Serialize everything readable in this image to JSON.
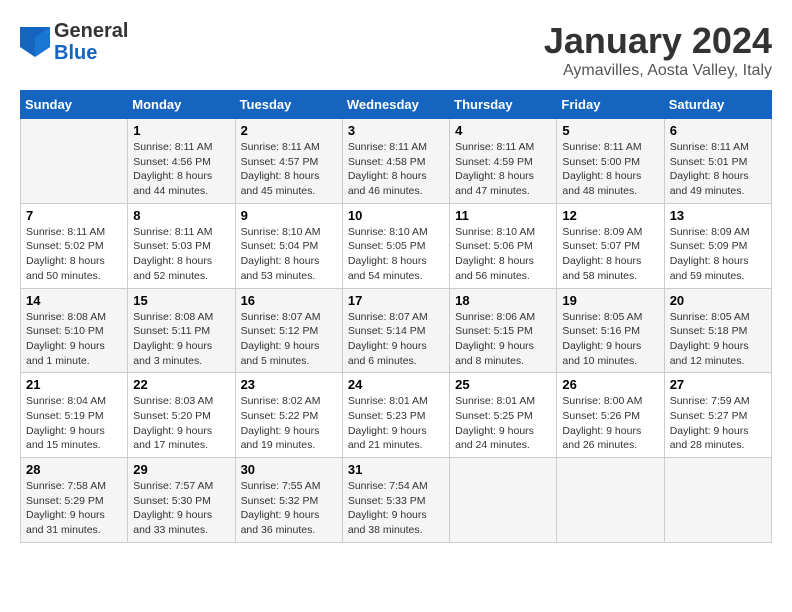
{
  "header": {
    "logo_line1": "General",
    "logo_line2": "Blue",
    "month": "January 2024",
    "location": "Aymavilles, Aosta Valley, Italy"
  },
  "days_of_week": [
    "Sunday",
    "Monday",
    "Tuesday",
    "Wednesday",
    "Thursday",
    "Friday",
    "Saturday"
  ],
  "weeks": [
    [
      {
        "day": "",
        "info": ""
      },
      {
        "day": "1",
        "info": "Sunrise: 8:11 AM\nSunset: 4:56 PM\nDaylight: 8 hours\nand 44 minutes."
      },
      {
        "day": "2",
        "info": "Sunrise: 8:11 AM\nSunset: 4:57 PM\nDaylight: 8 hours\nand 45 minutes."
      },
      {
        "day": "3",
        "info": "Sunrise: 8:11 AM\nSunset: 4:58 PM\nDaylight: 8 hours\nand 46 minutes."
      },
      {
        "day": "4",
        "info": "Sunrise: 8:11 AM\nSunset: 4:59 PM\nDaylight: 8 hours\nand 47 minutes."
      },
      {
        "day": "5",
        "info": "Sunrise: 8:11 AM\nSunset: 5:00 PM\nDaylight: 8 hours\nand 48 minutes."
      },
      {
        "day": "6",
        "info": "Sunrise: 8:11 AM\nSunset: 5:01 PM\nDaylight: 8 hours\nand 49 minutes."
      }
    ],
    [
      {
        "day": "7",
        "info": "Sunrise: 8:11 AM\nSunset: 5:02 PM\nDaylight: 8 hours\nand 50 minutes."
      },
      {
        "day": "8",
        "info": "Sunrise: 8:11 AM\nSunset: 5:03 PM\nDaylight: 8 hours\nand 52 minutes."
      },
      {
        "day": "9",
        "info": "Sunrise: 8:10 AM\nSunset: 5:04 PM\nDaylight: 8 hours\nand 53 minutes."
      },
      {
        "day": "10",
        "info": "Sunrise: 8:10 AM\nSunset: 5:05 PM\nDaylight: 8 hours\nand 54 minutes."
      },
      {
        "day": "11",
        "info": "Sunrise: 8:10 AM\nSunset: 5:06 PM\nDaylight: 8 hours\nand 56 minutes."
      },
      {
        "day": "12",
        "info": "Sunrise: 8:09 AM\nSunset: 5:07 PM\nDaylight: 8 hours\nand 58 minutes."
      },
      {
        "day": "13",
        "info": "Sunrise: 8:09 AM\nSunset: 5:09 PM\nDaylight: 8 hours\nand 59 minutes."
      }
    ],
    [
      {
        "day": "14",
        "info": "Sunrise: 8:08 AM\nSunset: 5:10 PM\nDaylight: 9 hours\nand 1 minute."
      },
      {
        "day": "15",
        "info": "Sunrise: 8:08 AM\nSunset: 5:11 PM\nDaylight: 9 hours\nand 3 minutes."
      },
      {
        "day": "16",
        "info": "Sunrise: 8:07 AM\nSunset: 5:12 PM\nDaylight: 9 hours\nand 5 minutes."
      },
      {
        "day": "17",
        "info": "Sunrise: 8:07 AM\nSunset: 5:14 PM\nDaylight: 9 hours\nand 6 minutes."
      },
      {
        "day": "18",
        "info": "Sunrise: 8:06 AM\nSunset: 5:15 PM\nDaylight: 9 hours\nand 8 minutes."
      },
      {
        "day": "19",
        "info": "Sunrise: 8:05 AM\nSunset: 5:16 PM\nDaylight: 9 hours\nand 10 minutes."
      },
      {
        "day": "20",
        "info": "Sunrise: 8:05 AM\nSunset: 5:18 PM\nDaylight: 9 hours\nand 12 minutes."
      }
    ],
    [
      {
        "day": "21",
        "info": "Sunrise: 8:04 AM\nSunset: 5:19 PM\nDaylight: 9 hours\nand 15 minutes."
      },
      {
        "day": "22",
        "info": "Sunrise: 8:03 AM\nSunset: 5:20 PM\nDaylight: 9 hours\nand 17 minutes."
      },
      {
        "day": "23",
        "info": "Sunrise: 8:02 AM\nSunset: 5:22 PM\nDaylight: 9 hours\nand 19 minutes."
      },
      {
        "day": "24",
        "info": "Sunrise: 8:01 AM\nSunset: 5:23 PM\nDaylight: 9 hours\nand 21 minutes."
      },
      {
        "day": "25",
        "info": "Sunrise: 8:01 AM\nSunset: 5:25 PM\nDaylight: 9 hours\nand 24 minutes."
      },
      {
        "day": "26",
        "info": "Sunrise: 8:00 AM\nSunset: 5:26 PM\nDaylight: 9 hours\nand 26 minutes."
      },
      {
        "day": "27",
        "info": "Sunrise: 7:59 AM\nSunset: 5:27 PM\nDaylight: 9 hours\nand 28 minutes."
      }
    ],
    [
      {
        "day": "28",
        "info": "Sunrise: 7:58 AM\nSunset: 5:29 PM\nDaylight: 9 hours\nand 31 minutes."
      },
      {
        "day": "29",
        "info": "Sunrise: 7:57 AM\nSunset: 5:30 PM\nDaylight: 9 hours\nand 33 minutes."
      },
      {
        "day": "30",
        "info": "Sunrise: 7:55 AM\nSunset: 5:32 PM\nDaylight: 9 hours\nand 36 minutes."
      },
      {
        "day": "31",
        "info": "Sunrise: 7:54 AM\nSunset: 5:33 PM\nDaylight: 9 hours\nand 38 minutes."
      },
      {
        "day": "",
        "info": ""
      },
      {
        "day": "",
        "info": ""
      },
      {
        "day": "",
        "info": ""
      }
    ]
  ]
}
